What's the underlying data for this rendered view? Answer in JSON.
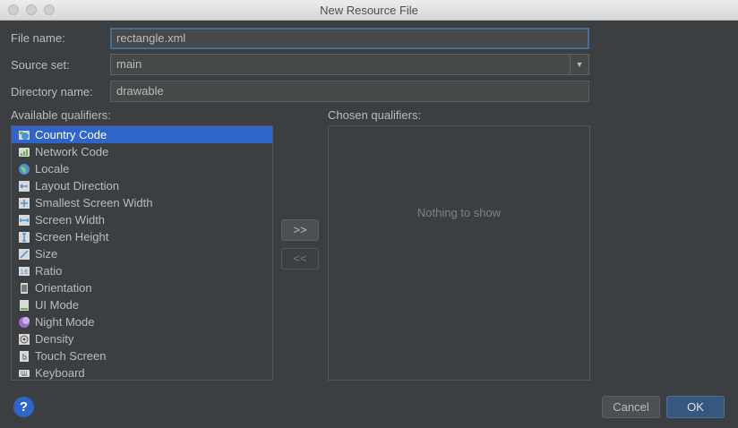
{
  "window": {
    "title": "New Resource File"
  },
  "form": {
    "file_name_label": "File name:",
    "file_name_value": "rectangle.xml",
    "source_set_label": "Source set:",
    "source_set_value": "main",
    "directory_label": "Directory name:",
    "directory_value": "drawable"
  },
  "available": {
    "label": "Available qualifiers:",
    "items": [
      {
        "label": "Country Code",
        "icon": "country-code-icon",
        "selected": true
      },
      {
        "label": "Network Code",
        "icon": "network-code-icon"
      },
      {
        "label": "Locale",
        "icon": "globe-icon"
      },
      {
        "label": "Layout Direction",
        "icon": "layout-direction-icon"
      },
      {
        "label": "Smallest Screen Width",
        "icon": "smallest-width-icon"
      },
      {
        "label": "Screen Width",
        "icon": "screen-width-icon"
      },
      {
        "label": "Screen Height",
        "icon": "screen-height-icon"
      },
      {
        "label": "Size",
        "icon": "size-icon"
      },
      {
        "label": "Ratio",
        "icon": "ratio-icon"
      },
      {
        "label": "Orientation",
        "icon": "orientation-icon"
      },
      {
        "label": "UI Mode",
        "icon": "ui-mode-icon"
      },
      {
        "label": "Night Mode",
        "icon": "night-mode-icon"
      },
      {
        "label": "Density",
        "icon": "density-icon"
      },
      {
        "label": "Touch Screen",
        "icon": "touch-screen-icon"
      },
      {
        "label": "Keyboard",
        "icon": "keyboard-icon"
      }
    ]
  },
  "buttons": {
    "add": ">>",
    "remove": "<<",
    "cancel": "Cancel",
    "ok": "OK",
    "help": "?"
  },
  "chosen": {
    "label": "Chosen qualifiers:",
    "empty_text": "Nothing to show"
  },
  "colors": {
    "selection": "#2f65ca",
    "background": "#3c3f41",
    "ok_button": "#365880"
  }
}
